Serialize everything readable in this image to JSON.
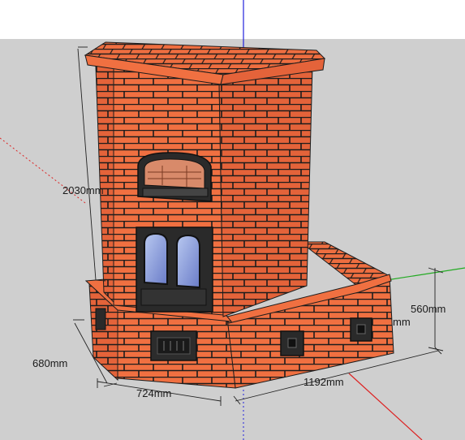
{
  "scene": {
    "sky_color": "#ffffff",
    "ground_color": "#cfcfcf",
    "brick_color": "#f07041",
    "mortar_color": "#1c1c1c",
    "axis_colors": {
      "blue": "#2222dd",
      "green": "#22aa22",
      "red": "#dd2222"
    }
  },
  "dimensions": {
    "height_label": "2030mm",
    "depth_label": "680mm",
    "front_width_label": "724mm",
    "bench_length_label": "1192mm",
    "bench_height_label": "560mm",
    "partial_label": "mm"
  },
  "components": {
    "fire_door": "fire-door-glass",
    "oven_door": "oven-door-glass",
    "ash_door": "ash-door",
    "bench_vent_1": "bench-vent-square",
    "bench_vent_2": "bench-vent-square"
  }
}
